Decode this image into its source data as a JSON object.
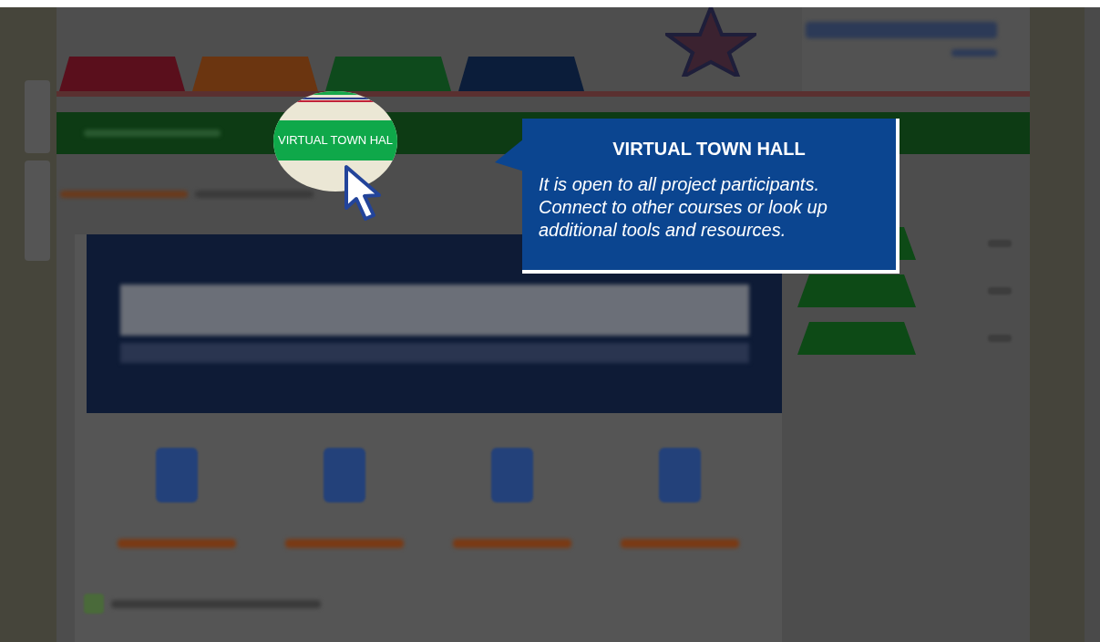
{
  "header_tabs": [
    {
      "color": "#5a0f1c"
    },
    {
      "color": "#6b3510"
    },
    {
      "color": "#0e4a1c"
    },
    {
      "color": "#0b1d3a"
    }
  ],
  "magnifier": {
    "label": "VIRTUAL TOWN HAL"
  },
  "tooltip": {
    "title": "VIRTUAL TOWN HALL",
    "body": "It is open to all project participants. Connect to other courses or look up additional tools and resources."
  }
}
